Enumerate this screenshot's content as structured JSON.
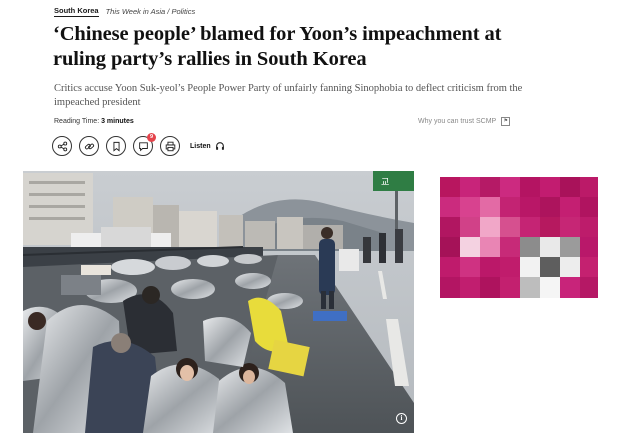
{
  "breadcrumb": {
    "section": "South Korea",
    "subsection": "This Week in Asia / Politics"
  },
  "article": {
    "headline": "‘Chinese people’ blamed for Yoon’s impeachment at ruling party’s rallies in South Korea",
    "standfirst": "Critics accuse Yoon Suk-yeol’s People Power Party of unfairly fanning Sinophobia to deflect criticism from the impeached president",
    "reading_time_label": "Reading Time:",
    "reading_time_value": "3 minutes",
    "trust_link": "Why you can trust SCMP",
    "trust_icon": "flag-icon"
  },
  "actions": {
    "share_icon": "share-icon",
    "link_icon": "link-icon",
    "bookmark_icon": "bookmark-icon",
    "comment_icon": "comment-icon",
    "comment_count": "9",
    "print_icon": "print-icon",
    "listen_label": "Listen",
    "listen_icon": "headphones-icon"
  },
  "media": {
    "info_icon": "info-icon",
    "info_glyph": "i",
    "street_sign": "교"
  },
  "colors": {
    "badge": "#e4434b",
    "ad_magenta": "#c0186a",
    "text_dark": "#111111",
    "text_muted": "#555555"
  }
}
